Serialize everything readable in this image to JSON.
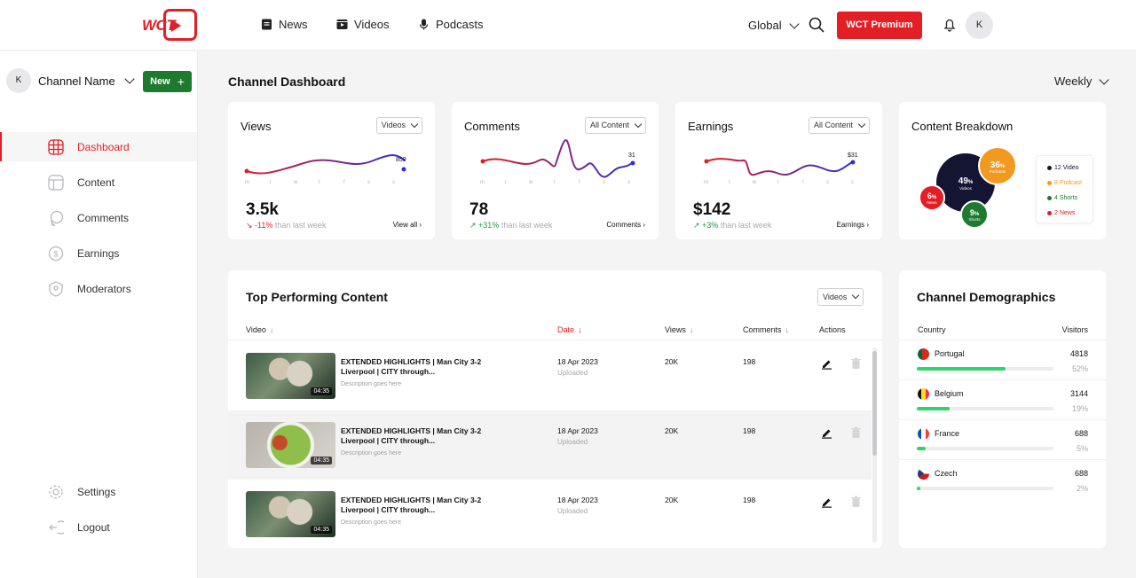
{
  "header": {
    "logo_text": "WCT",
    "nav": [
      "News",
      "Videos",
      "Podcasts"
    ],
    "region": "Global",
    "premium_label": "WCT Premium",
    "user_initial": "K"
  },
  "sidebar": {
    "user_initial": "K",
    "channel_name": "Channel Name",
    "new_label": "New",
    "items": [
      {
        "label": "Dashboard",
        "icon": "grid-icon",
        "active": true
      },
      {
        "label": "Content",
        "icon": "content-icon",
        "active": false
      },
      {
        "label": "Comments",
        "icon": "comments-icon",
        "active": false
      },
      {
        "label": "Earnings",
        "icon": "earnings-icon",
        "active": false
      },
      {
        "label": "Moderators",
        "icon": "moderators-icon",
        "active": false
      }
    ],
    "bottom": [
      {
        "label": "Settings",
        "icon": "settings-icon"
      },
      {
        "label": "Logout",
        "icon": "logout-icon"
      }
    ]
  },
  "main": {
    "title": "Channel Dashboard",
    "period": "Weekly"
  },
  "stats": [
    {
      "title": "Views",
      "filter": "Videos",
      "value": "3.5k",
      "delta": "-11%",
      "delta_dir": "down",
      "delta_rest": "than last week",
      "link": "View all",
      "end_label": "859"
    },
    {
      "title": "Comments",
      "filter": "All Content",
      "value": "78",
      "delta": "+31%",
      "delta_dir": "up",
      "delta_rest": "than last week",
      "link": "Comments",
      "end_label": "31"
    },
    {
      "title": "Earnings",
      "filter": "All Content",
      "value": "$142",
      "delta": "+3%",
      "delta_dir": "up",
      "delta_rest": "than last week",
      "link": "Earnings",
      "end_label": "$31"
    }
  ],
  "day_labels": [
    "m",
    "t",
    "w",
    "t",
    "f",
    "s",
    "s"
  ],
  "breakdown": {
    "title": "Content Breakdown",
    "bubbles": [
      {
        "pct": "49",
        "label": "Videos",
        "color": "#141433"
      },
      {
        "pct": "36",
        "label": "Podcasts",
        "color": "#f29a1f"
      },
      {
        "pct": "6",
        "label": "News",
        "color": "#e31e24"
      },
      {
        "pct": "9",
        "label": "Shorts",
        "color": "#1d7a2e"
      }
    ],
    "legend": [
      {
        "text": "12 Video",
        "color": "#141433"
      },
      {
        "text": "8 Podcast",
        "color": "#f29a1f"
      },
      {
        "text": "4 Shorts",
        "color": "#1d7a2e"
      },
      {
        "text": "2 News",
        "color": "#e31e24"
      }
    ]
  },
  "top_content": {
    "title": "Top Performing Content",
    "filter": "Videos",
    "columns": [
      "Video",
      "Date",
      "Views",
      "Comments",
      "Actions"
    ],
    "rows": [
      {
        "title": "EXTENDED HIGHLIGHTS | Man City 3-2 Liverpool | CITY through...",
        "desc": "Description goes here",
        "date": "18 Apr 2023",
        "status": "Uploaded",
        "views": "20K",
        "comments": "198",
        "duration": "04:35",
        "thumb": "cat"
      },
      {
        "title": "EXTENDED HIGHLIGHTS | Man City 3-2 Liverpool | CITY through...",
        "desc": "Description goes here",
        "date": "18 Apr 2023",
        "status": "Uploaded",
        "views": "20K",
        "comments": "198",
        "duration": "04:35",
        "thumb": "salad"
      },
      {
        "title": "EXTENDED HIGHLIGHTS | Man City 3-2 Liverpool | CITY through...",
        "desc": "Description goes here",
        "date": "18 Apr 2023",
        "status": "Uploaded",
        "views": "20K",
        "comments": "198",
        "duration": "04:35",
        "thumb": "cat"
      }
    ]
  },
  "demographics": {
    "title": "Channel Demographics",
    "col_country": "Country",
    "col_visitors": "Visitors",
    "rows": [
      {
        "country": "Portugal",
        "visitors": "4818",
        "pct": "52%",
        "share": 0.52
      },
      {
        "country": "Belgium",
        "visitors": "3144",
        "pct": "19%",
        "share": 0.19
      },
      {
        "country": "France",
        "visitors": "688",
        "pct": "5%",
        "share": 0.05
      },
      {
        "country": "Czech",
        "visitors": "688",
        "pct": "2%",
        "share": 0.02
      }
    ]
  }
}
